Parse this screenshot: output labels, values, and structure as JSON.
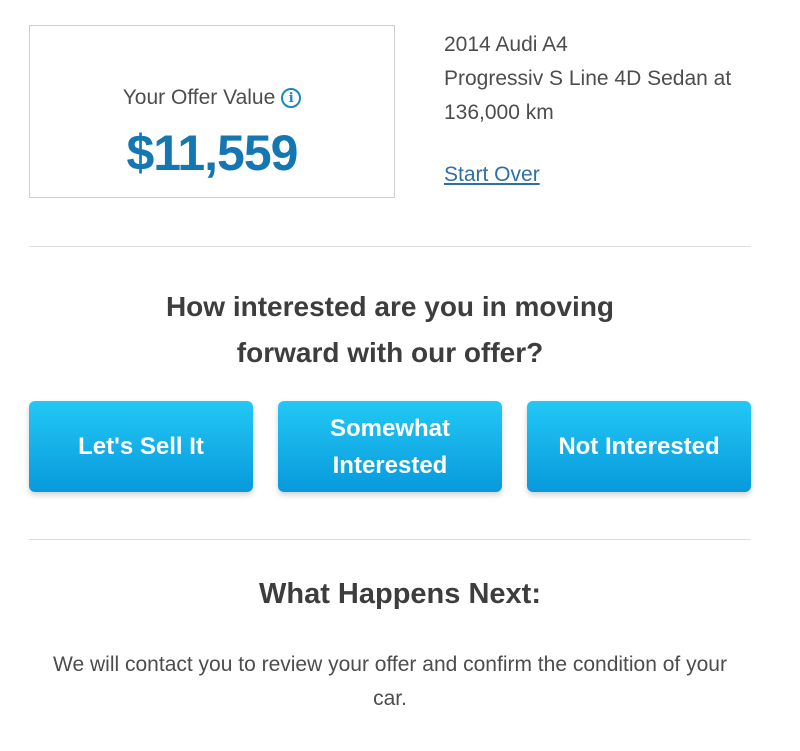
{
  "offer": {
    "label": "Your Offer Value",
    "info_icon": "info-circle-icon",
    "value": "$11,559"
  },
  "vehicle": {
    "title": "2014 Audi A4",
    "description": "Progressiv S Line 4D Sedan at 136,000 km"
  },
  "start_over_label": "Start Over",
  "question": {
    "line1": "How interested are you in moving",
    "line2": "forward with our offer?"
  },
  "buttons": {
    "sell": "Let's Sell It",
    "somewhat_line1": "Somewhat",
    "somewhat_line2": "Interested",
    "not_interested": "Not Interested"
  },
  "next": {
    "heading": "What Happens Next:",
    "body": "We will contact you to review your offer and confirm the condition of your car."
  },
  "colors": {
    "accent": "#1477b3",
    "button_top": "#23c8f5",
    "button_bottom": "#0899dc",
    "link": "#2f6fa7"
  }
}
